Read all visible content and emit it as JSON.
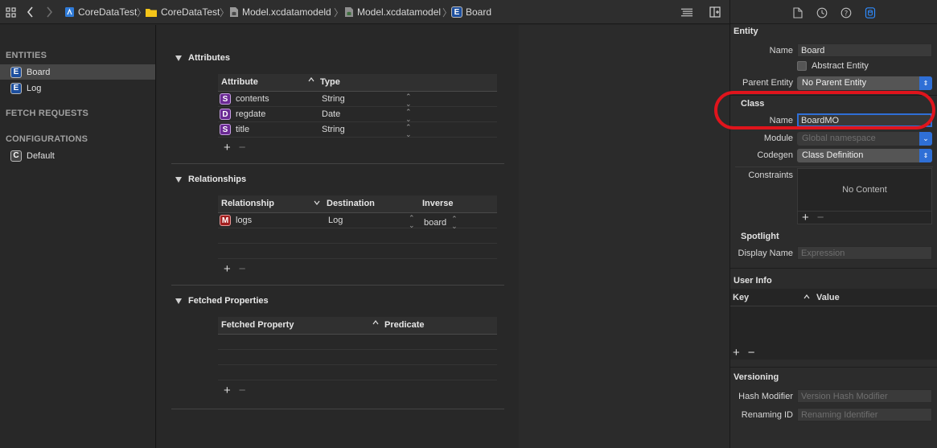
{
  "breadcrumb": {
    "items": [
      {
        "label": "CoreDataTest",
        "icon": "project-icon"
      },
      {
        "label": "CoreDataTest",
        "icon": "folder-icon"
      },
      {
        "label": "Model.xcdatamodeld",
        "icon": "datamodel-bundle-icon"
      },
      {
        "label": "Model.xcdatamodel",
        "icon": "datamodel-file-icon"
      },
      {
        "label": "Board",
        "icon": "entity-icon"
      }
    ]
  },
  "sidebar": {
    "entities_header": "ENTITIES",
    "entities": [
      {
        "badge": "E",
        "label": "Board",
        "selected": true
      },
      {
        "badge": "E",
        "label": "Log",
        "selected": false
      }
    ],
    "fetch_requests_header": "FETCH REQUESTS",
    "configurations_header": "CONFIGURATIONS",
    "configurations": [
      {
        "badge": "C",
        "label": "Default"
      }
    ]
  },
  "attributes": {
    "title": "Attributes",
    "columns": [
      "Attribute",
      "Type"
    ],
    "rows": [
      {
        "badge": "S",
        "name": "contents",
        "type": "String"
      },
      {
        "badge": "D",
        "name": "regdate",
        "type": "Date"
      },
      {
        "badge": "S",
        "name": "title",
        "type": "String"
      }
    ]
  },
  "relationships": {
    "title": "Relationships",
    "columns": [
      "Relationship",
      "Destination",
      "Inverse"
    ],
    "rows": [
      {
        "badge": "M",
        "name": "logs",
        "destination": "Log",
        "inverse": "board"
      }
    ]
  },
  "fetched_properties": {
    "title": "Fetched Properties",
    "columns": [
      "Fetched Property",
      "Predicate"
    ]
  },
  "inspector": {
    "entity_header": "Entity",
    "name_label": "Name",
    "name_value": "Board",
    "abstract_label": "Abstract Entity",
    "parent_label": "Parent Entity",
    "parent_value": "No Parent Entity",
    "class_header": "Class",
    "class_name_label": "Name",
    "class_name_value": "BoardMO",
    "module_label": "Module",
    "module_placeholder": "Global namespace",
    "codegen_label": "Codegen",
    "codegen_value": "Class Definition",
    "constraints_label": "Constraints",
    "constraints_empty": "No Content",
    "spotlight_header": "Spotlight",
    "display_name_label": "Display Name",
    "display_name_placeholder": "Expression",
    "user_info_header": "User Info",
    "user_info_columns": [
      "Key",
      "Value"
    ],
    "versioning_header": "Versioning",
    "hash_label": "Hash Modifier",
    "hash_placeholder": "Version Hash Modifier",
    "renaming_label": "Renaming ID",
    "renaming_placeholder": "Renaming Identifier"
  },
  "colors": {
    "accent": "#2f6fd6",
    "highlight_ring": "#e0141c",
    "entity_badge": "#1d4f9e",
    "attribute_badge": "#6a2a93",
    "relationship_badge": "#a11e1e"
  }
}
